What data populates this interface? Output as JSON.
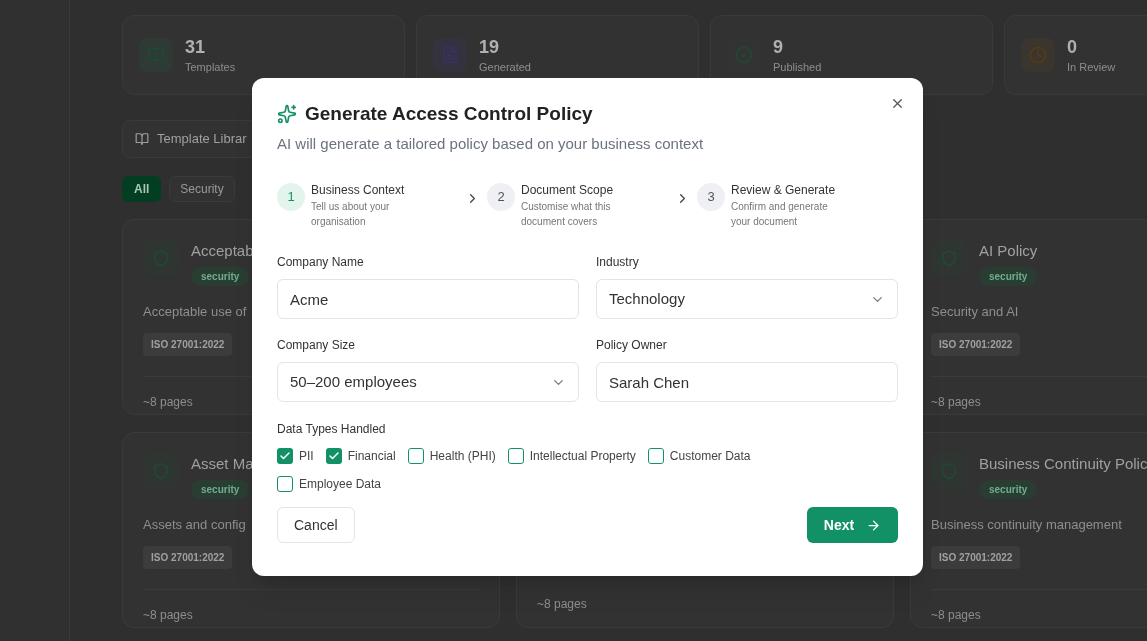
{
  "stats": [
    {
      "kind": "book",
      "value": "31",
      "label": "Templates"
    },
    {
      "kind": "document",
      "value": "19",
      "label": "Generated"
    },
    {
      "kind": "check",
      "value": "9",
      "label": "Published"
    },
    {
      "kind": "clock",
      "value": "0",
      "label": "In Review"
    }
  ],
  "toolbar": {
    "library_button": "Template Librar"
  },
  "filters": [
    {
      "label": "All",
      "selected": true
    },
    {
      "label": "Security",
      "selected": false
    }
  ],
  "templates": [
    {
      "title": "Acceptab",
      "tag": "security",
      "description": "Acceptable use of",
      "standard": "ISO 27001:2022",
      "pages": "~8 pages"
    },
    {
      "title": "AI Policy",
      "tag": "security",
      "description": "Security and AI",
      "standard": "ISO 27001:2022",
      "pages": "~8 pages"
    },
    {
      "title": "Asset Ma",
      "tag": "security",
      "description": "Assets and config",
      "standard": "ISO 27001:2022",
      "pages": "~8 pages"
    },
    {
      "pages": "~8 pages"
    },
    {
      "title": "Business Continuity Polic",
      "tag": "security",
      "description": "Business continuity management",
      "standard": "ISO 27001:2022",
      "pages": "~8 pages"
    }
  ],
  "dialog": {
    "title": "Generate Access Control Policy",
    "subtitle": "AI will generate a tailored policy based on your business context",
    "steps": [
      {
        "number": "1",
        "title": "Business Context",
        "description": "Tell us about your organisation",
        "selected": true
      },
      {
        "number": "2",
        "title": "Document Scope",
        "description": "Customise what this document covers",
        "selected": false
      },
      {
        "number": "3",
        "title": "Review & Generate",
        "description": "Confirm and generate your document",
        "selected": false
      }
    ],
    "fields": [
      {
        "label": "Company Name",
        "value": "Acme",
        "kind": "text"
      },
      {
        "label": "Industry",
        "value": "Technology",
        "kind": "select"
      },
      {
        "label": "Company Size",
        "value": "50–200 employees",
        "kind": "select"
      },
      {
        "label": "Policy Owner",
        "value": "Sarah Chen",
        "kind": "text"
      }
    ],
    "data_types": {
      "label": "Data Types Handled",
      "options": [
        {
          "label": "PII",
          "checked": true
        },
        {
          "label": "Financial",
          "checked": true
        },
        {
          "label": "Health (PHI)",
          "checked": false
        },
        {
          "label": "Intellectual Property",
          "checked": false
        },
        {
          "label": "Customer Data",
          "checked": false
        },
        {
          "label": "Employee Data",
          "checked": false
        }
      ]
    },
    "cancel_button": "Cancel",
    "next_button": "Next"
  }
}
